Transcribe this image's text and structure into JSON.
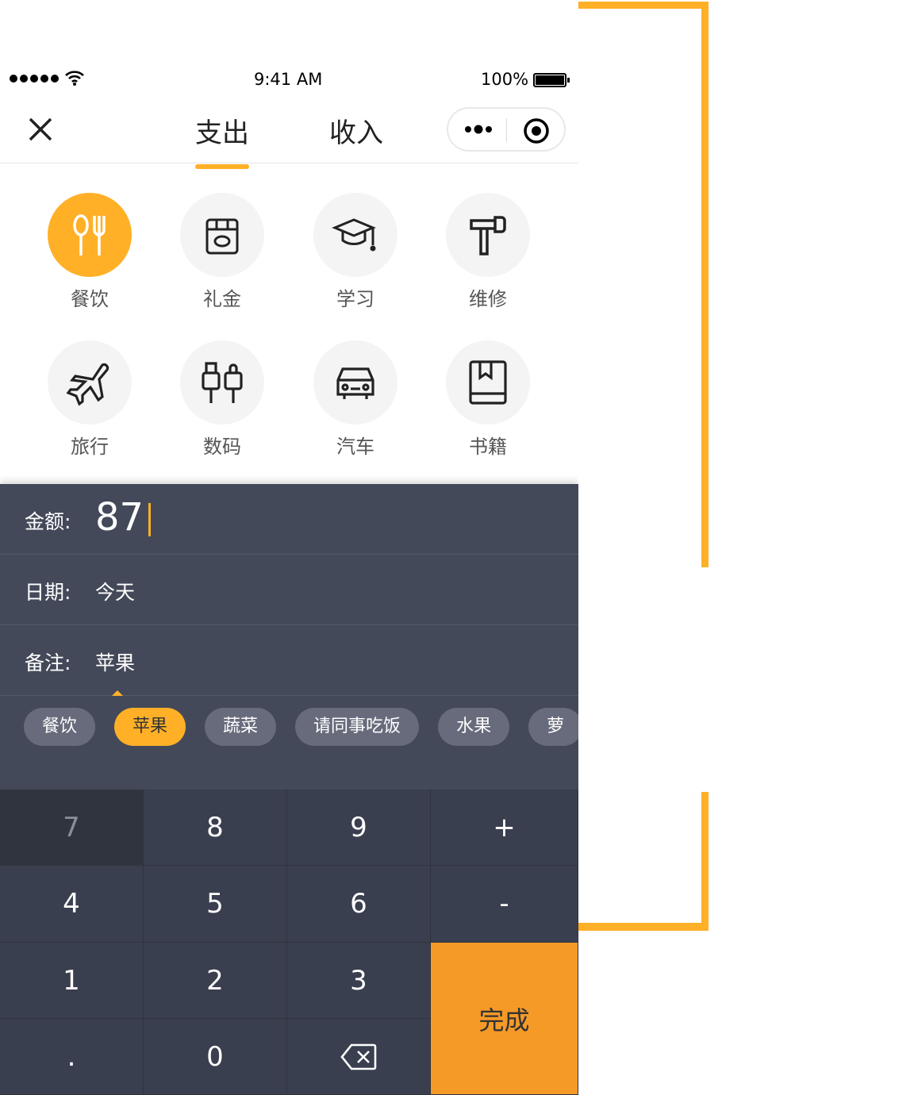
{
  "colors": {
    "accent": "#ffb027",
    "panel": "#434959",
    "keyboard": "#3a3f4f",
    "done": "#f59a27"
  },
  "status": {
    "time": "9:41 AM",
    "battery": "100%"
  },
  "nav": {
    "tabs": [
      "支出",
      "收入"
    ],
    "active_tab": "支出"
  },
  "categories": [
    {
      "label": "餐饮",
      "icon": "utensils-icon",
      "selected": true
    },
    {
      "label": "礼金",
      "icon": "gift-envelope-icon"
    },
    {
      "label": "学习",
      "icon": "graduation-cap-icon"
    },
    {
      "label": "维修",
      "icon": "hammer-icon"
    },
    {
      "label": "旅行",
      "icon": "airplane-icon"
    },
    {
      "label": "数码",
      "icon": "plug-icon"
    },
    {
      "label": "汽车",
      "icon": "car-icon"
    },
    {
      "label": "书籍",
      "icon": "book-icon"
    }
  ],
  "form": {
    "amount_label": "金额:",
    "amount_value": "87",
    "date_label": "日期:",
    "date_value": "今天",
    "note_label": "备注:",
    "note_value": "苹果"
  },
  "chips": [
    {
      "label": "餐饮"
    },
    {
      "label": "苹果",
      "selected": true
    },
    {
      "label": "蔬菜"
    },
    {
      "label": "请同事吃饭"
    },
    {
      "label": "水果"
    },
    {
      "label": "萝"
    }
  ],
  "keypad": {
    "keys": [
      "7",
      "8",
      "9",
      "+",
      "4",
      "5",
      "6",
      "-",
      "1",
      "2",
      "3",
      ".",
      "0"
    ],
    "done": "完成",
    "pressed": "7"
  }
}
